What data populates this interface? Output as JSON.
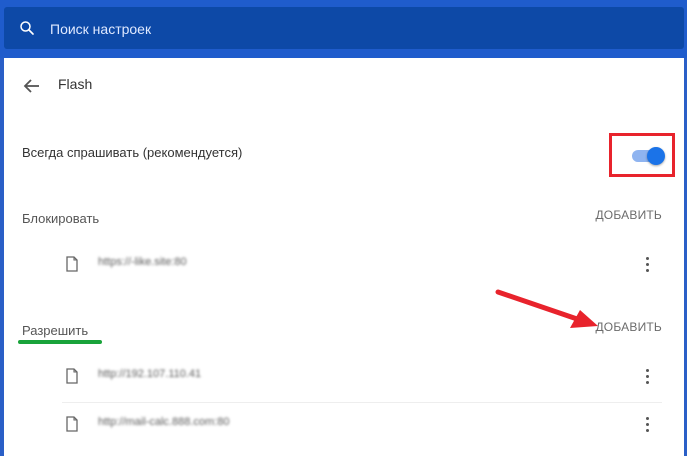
{
  "search": {
    "placeholder": "Поиск настроек"
  },
  "header": {
    "title": "Flash"
  },
  "ask": {
    "label": "Всегда спрашивать (рекомендуется)",
    "toggle_on": true
  },
  "block": {
    "title": "Блокировать",
    "add_label": "ДОБАВИТЬ",
    "sites": [
      {
        "url": "https://-like.site:80"
      }
    ]
  },
  "allow": {
    "title": "Разрешить",
    "add_label": "ДОБАВИТЬ",
    "sites": [
      {
        "url": "http://192.107.110.41"
      },
      {
        "url": "http://mail-calc.888.com:80"
      }
    ]
  },
  "colors": {
    "topbar": "#1f5ccc",
    "search_bg": "#0d49a7",
    "toggle_accent": "#1b73e8",
    "highlight_red": "#e8232c",
    "underline_green": "#19a33a"
  }
}
